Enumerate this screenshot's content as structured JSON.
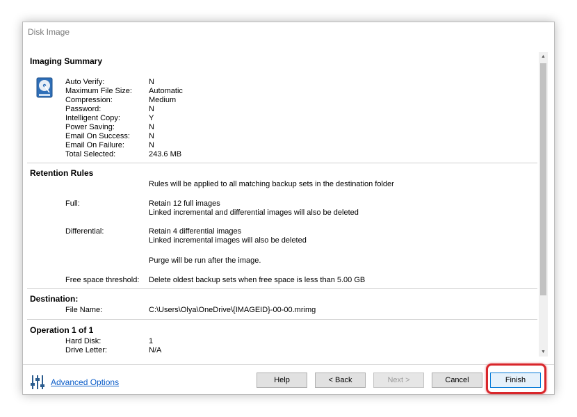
{
  "window": {
    "title": "Disk Image"
  },
  "summary": {
    "title": "Imaging Summary",
    "rows": [
      {
        "key": "Auto Verify:",
        "value": "N"
      },
      {
        "key": "Maximum File Size:",
        "value": "Automatic"
      },
      {
        "key": "Compression:",
        "value": "Medium"
      },
      {
        "key": "Password:",
        "value": "N"
      },
      {
        "key": "Intelligent Copy:",
        "value": "Y"
      },
      {
        "key": "Power Saving:",
        "value": "N"
      },
      {
        "key": "Email On Success:",
        "value": "N"
      },
      {
        "key": "Email On Failure:",
        "value": "N"
      },
      {
        "key": "Total Selected:",
        "value": "243.6 MB"
      }
    ]
  },
  "retention": {
    "title": "Retention Rules",
    "intro": "Rules will be applied to all matching backup sets in the destination folder",
    "full_label": "Full:",
    "full_line1": "Retain 12 full images",
    "full_line2": "Linked incremental and differential images will also be deleted",
    "diff_label": "Differential:",
    "diff_line1": "Retain 4 differential images",
    "diff_line2": "Linked incremental images will also be deleted",
    "purge": "Purge will be run after the image.",
    "threshold_label": "Free space threshold:",
    "threshold_value": "Delete oldest backup sets when free space is less than 5.00 GB"
  },
  "destination": {
    "title": "Destination:",
    "file_label": "File Name:",
    "file_value": "C:\\Users\\Olya\\OneDrive\\{IMAGEID}-00-00.mrimg"
  },
  "operation": {
    "title": "Operation 1 of 1",
    "rows": [
      {
        "key": "Hard Disk:",
        "value": "1"
      },
      {
        "key": "Drive Letter:",
        "value": "N/A"
      }
    ]
  },
  "footer": {
    "advanced_options": "Advanced Options",
    "help": "Help",
    "back": "< Back",
    "next": "Next >",
    "cancel": "Cancel",
    "finish": "Finish"
  },
  "colors": {
    "accent": "#0078d7",
    "link": "#0b5dc9",
    "highlight": "#d9262b"
  },
  "icons": {
    "disk": "hard-disk-icon",
    "advanced": "sliders-icon"
  }
}
